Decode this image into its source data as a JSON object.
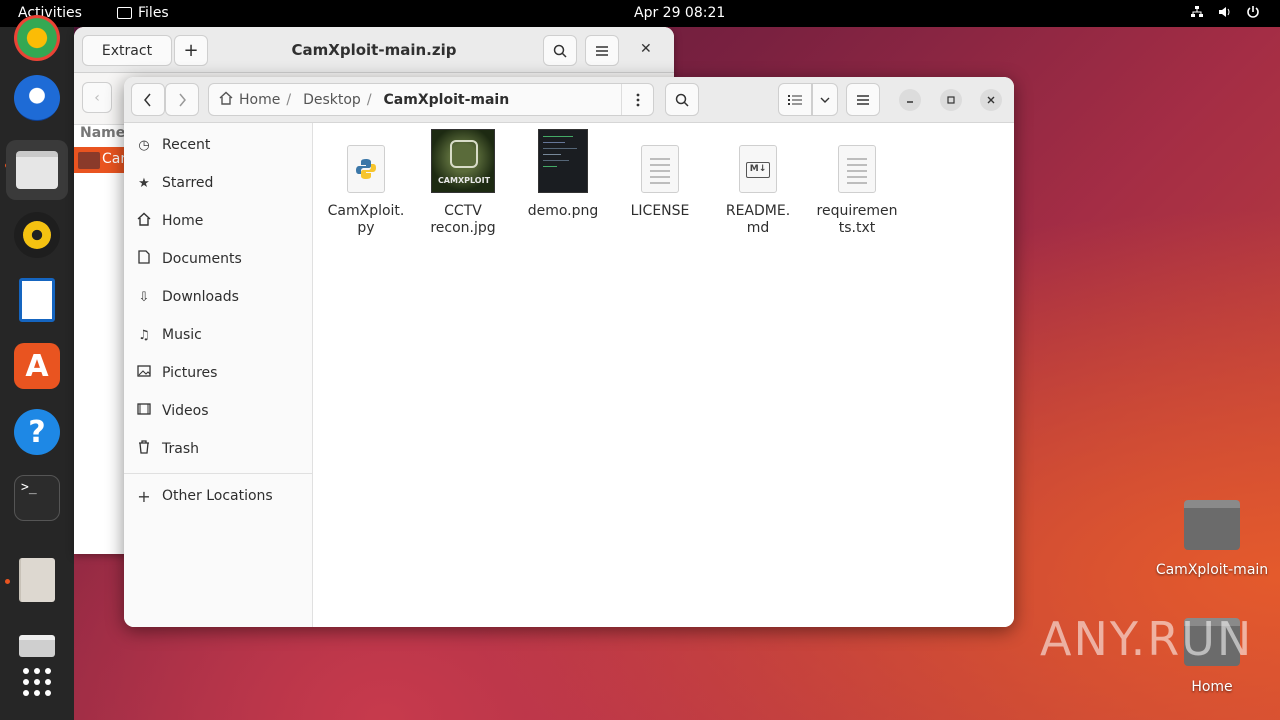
{
  "topbar": {
    "activities": "Activities",
    "app_name": "Files",
    "clock": "Apr 29  08:21"
  },
  "archive_window": {
    "extract_label": "Extract",
    "add_label": "+",
    "title": "CamXploit-main.zip",
    "column_name": "Name",
    "selected_item": "Cam"
  },
  "files_window": {
    "breadcrumbs": [
      "Home",
      "/",
      "Desktop",
      "/",
      "CamXploit-main"
    ],
    "sidebar": [
      {
        "label": "Recent",
        "icon": "clock-icon"
      },
      {
        "label": "Starred",
        "icon": "star-icon"
      },
      {
        "label": "Home",
        "icon": "home-icon"
      },
      {
        "label": "Documents",
        "icon": "document-icon"
      },
      {
        "label": "Downloads",
        "icon": "download-icon"
      },
      {
        "label": "Music",
        "icon": "music-icon"
      },
      {
        "label": "Pictures",
        "icon": "picture-icon"
      },
      {
        "label": "Videos",
        "icon": "video-icon"
      },
      {
        "label": "Trash",
        "icon": "trash-icon"
      },
      {
        "label": "Other Locations",
        "icon": "plus-icon"
      }
    ],
    "files": [
      {
        "name": "CamXploit.\npy",
        "type": "python"
      },
      {
        "name": "CCTV\nrecon.jpg",
        "type": "image",
        "thumb_text": "CAMXPLOIT"
      },
      {
        "name": "demo.png",
        "type": "image-dark"
      },
      {
        "name": "LICENSE",
        "type": "text"
      },
      {
        "name": "README.\nmd",
        "type": "markdown",
        "badge": "M↓"
      },
      {
        "name": "requiremen\nts.txt",
        "type": "text"
      }
    ]
  },
  "desktop": {
    "icons": [
      {
        "label": "CamXploit-main"
      },
      {
        "label": "Home"
      }
    ],
    "watermark": "ANY.RUN"
  },
  "colors": {
    "accent": "#e95420",
    "topbar": "#000000",
    "dock": "#262626"
  }
}
